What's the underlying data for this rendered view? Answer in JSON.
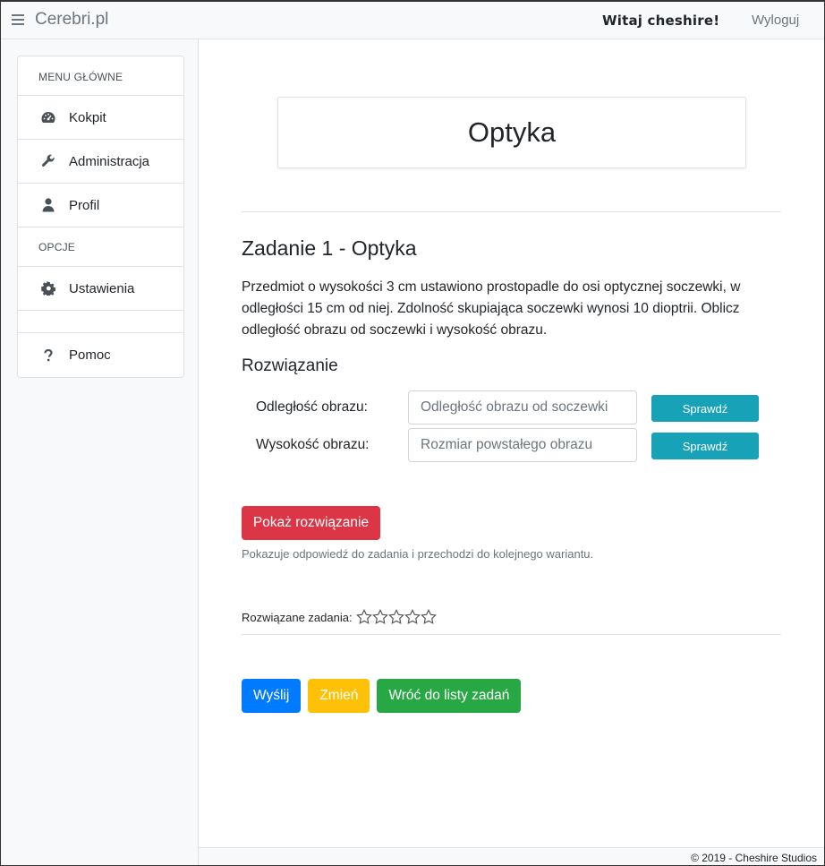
{
  "header": {
    "brand": "Cerebri.pl",
    "welcome": "Witaj cheshire!",
    "logout": "Wyloguj"
  },
  "sidebar": {
    "main_header": "MENU GŁÓWNE",
    "options_header": "OPCJE",
    "items": [
      {
        "label": "Kokpit",
        "icon": "dashboard-icon"
      },
      {
        "label": "Administracja",
        "icon": "wrench-icon"
      },
      {
        "label": "Profil",
        "icon": "user-icon"
      },
      {
        "label": "Ustawienia",
        "icon": "gear-icon"
      },
      {
        "label": "Pomoc",
        "icon": "question-icon"
      }
    ]
  },
  "main": {
    "page_title": "Optyka",
    "task_title": "Zadanie 1 - Optyka",
    "task_text": "Przedmiot o wysokości 3 cm ustawiono prostopadle do osi optycznej soczewki, w odległości 15 cm od niej. Zdolność skupiająca soczewki wynosi 10 dioptrii. Oblicz odległość obrazu od soczewki i wysokość obrazu.",
    "solution_title": "Rozwiązanie",
    "fields": [
      {
        "label": "Odległość obrazu:",
        "placeholder": "Odległość obrazu od soczewki",
        "button": "Sprawdź"
      },
      {
        "label": "Wysokość obrazu:",
        "placeholder": "Rozmiar powstałego obrazu",
        "button": "Sprawdź"
      }
    ],
    "show_solution": "Pokaż rozwiązanie",
    "show_solution_help": "Pokazuje odpowiedź do zadania i przechodzi do kolejnego wariantu.",
    "solved_label": "Rozwiązane zadania:",
    "solved_stars": {
      "filled": 0,
      "total": 5
    },
    "actions": {
      "send": "Wyślij",
      "change": "Zmień",
      "back": "Wróć do listy zadań"
    }
  },
  "footer": {
    "copyright": "© 2019 - Cheshire Studios"
  },
  "colors": {
    "info": "#17a2b8",
    "danger": "#dc3545",
    "primary": "#007bff",
    "warning": "#ffc107",
    "success": "#28a745"
  }
}
